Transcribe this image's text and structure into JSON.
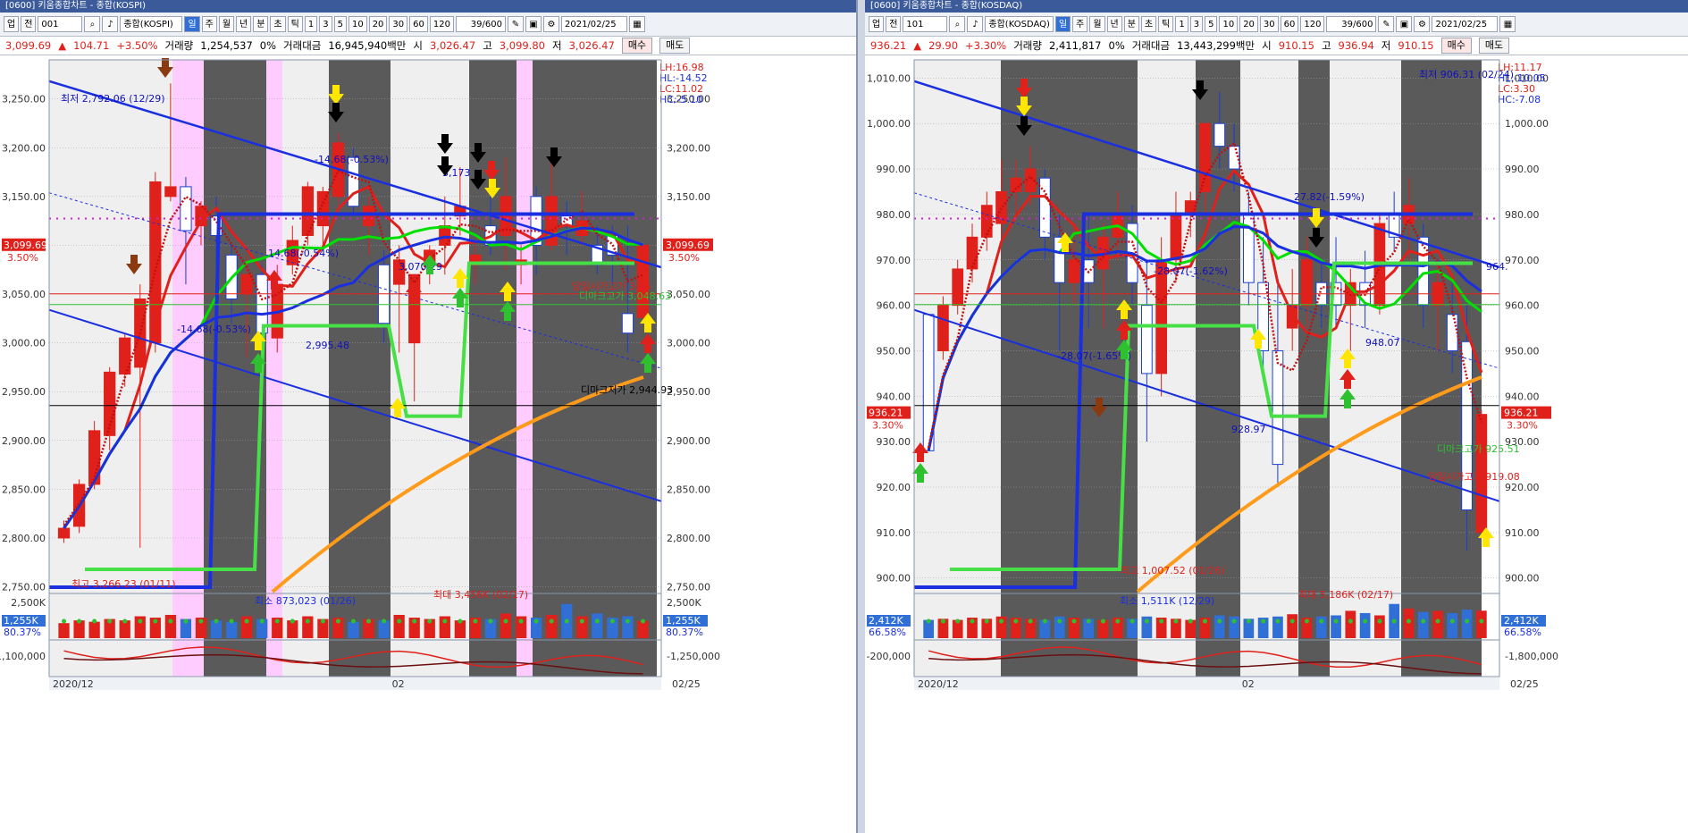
{
  "panels": [
    {
      "title": "[0600] 키움종합차트 - 종합(KOSPI)",
      "toolbar": {
        "buttons": [
          "업",
          "전"
        ],
        "code": "001",
        "name": "종합(KOSPI)",
        "period_tabs": [
          "일",
          "주",
          "월",
          "년",
          "분",
          "초",
          "틱"
        ],
        "active_tab": "일",
        "intervals": [
          "1",
          "3",
          "5",
          "10",
          "20",
          "30",
          "60",
          "120"
        ],
        "count": "39/600",
        "date": "2021/02/25"
      },
      "quote": {
        "price": "3,099.69",
        "arrow": "▲",
        "change": "104.71",
        "pct": "+3.50%",
        "vol_label": "거래량",
        "volume": "1,254,537",
        "zero_pct": "0%",
        "amt_label": "거래대금",
        "amount": "16,945,940백만",
        "open_label": "시",
        "open": "3,026.47",
        "high_label": "고",
        "high": "3,099.80",
        "low_label": "저",
        "low": "3,026.47",
        "buy": "매수",
        "sell": "매도"
      },
      "legend": {
        "lh": "LH:16.98",
        "hl": "HL:-14.52",
        "lc": "LC:11.02",
        "hc": "HC:-5.10"
      },
      "chart_data": {
        "type": "candlestick",
        "x_start": "2020/12",
        "x_mid": "02",
        "x_end": "02/25",
        "y_ticks": [
          "3,250.00",
          "3,200.00",
          "3,150.00",
          "3,100.00",
          "3,050.00",
          "3,000.00",
          "2,950.00",
          "2,900.00",
          "2,850.00",
          "2,800.00",
          "2,750.00"
        ],
        "ylim": [
          2745,
          3290
        ],
        "price_tag": "3,099.69",
        "price_tag_pct": "3.50%",
        "annotations": [
          "최저 2,792.06 (12/29)",
          "-14.68(-0.53%)",
          "3,173",
          "14.68(-0.54%)",
          "3,070.29",
          "-14.68(-0.53%)",
          "2,995.48",
          "당일시가고가 3,05",
          "디마크고가 3,048.63",
          "디마크저가 2,944.93",
          "최고 3,266.23 (01/11)"
        ],
        "candles": [
          [
            2800,
            2818,
            2795,
            2810
          ],
          [
            2812,
            2860,
            2805,
            2855
          ],
          [
            2855,
            2920,
            2850,
            2910
          ],
          [
            2905,
            2975,
            2890,
            2970
          ],
          [
            2968,
            3010,
            2955,
            3005
          ],
          [
            2975,
            3060,
            2790,
            3045
          ],
          [
            3000,
            3175,
            2990,
            3165
          ],
          [
            3150,
            3266,
            3145,
            3160
          ],
          [
            3160,
            3170,
            3060,
            3115
          ],
          [
            3120,
            3145,
            3100,
            3140
          ],
          [
            3130,
            3150,
            3080,
            3110
          ],
          [
            3090,
            3100,
            3020,
            3045
          ],
          [
            3050,
            3090,
            2985,
            3070
          ],
          [
            3070,
            3080,
            2990,
            3010
          ],
          [
            3005,
            3080,
            2990,
            3060
          ],
          [
            3080,
            3120,
            3070,
            3105
          ],
          [
            3110,
            3165,
            3100,
            3160
          ],
          [
            3120,
            3160,
            3100,
            3155
          ],
          [
            3150,
            3215,
            3140,
            3205
          ],
          [
            3190,
            3200,
            3130,
            3140
          ],
          [
            3120,
            3150,
            3090,
            3140
          ],
          [
            3080,
            3095,
            3000,
            3020
          ],
          [
            3060,
            3100,
            2990,
            3085
          ],
          [
            3000,
            3070,
            2940,
            3070
          ],
          [
            3080,
            3100,
            3060,
            3095
          ],
          [
            3100,
            3150,
            3070,
            3120
          ],
          [
            3130,
            3180,
            3110,
            3140
          ],
          [
            3080,
            3100,
            3060,
            3090
          ],
          [
            3120,
            3160,
            3090,
            3100
          ],
          [
            3110,
            3190,
            3075,
            3150
          ],
          [
            3080,
            3100,
            3060,
            3085
          ],
          [
            3150,
            3160,
            3070,
            3100
          ],
          [
            3100,
            3190,
            3095,
            3150
          ],
          [
            3130,
            3145,
            3090,
            3120
          ],
          [
            3110,
            3155,
            3100,
            3125
          ],
          [
            3100,
            3120,
            3070,
            3080
          ],
          [
            3110,
            3120,
            3060,
            3090
          ],
          [
            3030,
            3120,
            2990,
            3010
          ],
          [
            3026,
            3100,
            3026,
            3100
          ]
        ],
        "volume": {
          "label_top": "2,500K",
          "label_cur": "1,255K",
          "label_pct": "80.37%",
          "min_label": "최소 873,023 (01/26)",
          "max_label": "최대 3,456K (02/17)",
          "osc_label": "-1,100,000",
          "osc_label_r": "-1,250,000",
          "values": [
            1.1,
            1.3,
            1.2,
            1.4,
            1.3,
            1.6,
            1.5,
            1.7,
            1.4,
            1.5,
            1.3,
            1.2,
            1.6,
            1.4,
            1.5,
            1.3,
            1.6,
            1.4,
            1.5,
            1.2,
            1.4,
            1.3,
            1.7,
            1.5,
            1.4,
            1.6,
            1.3,
            1.5,
            1.4,
            1.8,
            1.6,
            1.5,
            1.7,
            2.5,
            1.6,
            1.8,
            1.5,
            1.6,
            1.26
          ]
        }
      }
    },
    {
      "title": "[0600] 키움종합차트 - 종합(KOSDAQ)",
      "toolbar": {
        "buttons": [
          "업",
          "전"
        ],
        "code": "101",
        "name": "종합(KOSDAQ)",
        "period_tabs": [
          "일",
          "주",
          "월",
          "년",
          "분",
          "초",
          "틱"
        ],
        "active_tab": "일",
        "intervals": [
          "1",
          "3",
          "5",
          "10",
          "20",
          "30",
          "60",
          "120"
        ],
        "count": "39/600",
        "date": "2021/02/25"
      },
      "quote": {
        "price": "936.21",
        "arrow": "▲",
        "change": "29.90",
        "pct": "+3.30%",
        "vol_label": "거래량",
        "volume": "2,411,817",
        "zero_pct": "0%",
        "amt_label": "거래대금",
        "amount": "13,443,299백만",
        "open_label": "시",
        "open": "910.15",
        "high_label": "고",
        "high": "936.94",
        "low_label": "저",
        "low": "910.15",
        "buy": "매수",
        "sell": "매도"
      },
      "legend": {
        "lh": "LH:11.17",
        "hl": "HL:-10.05",
        "lc": "LC:3.30",
        "hc": "HC:-7.08"
      },
      "chart_data": {
        "type": "candlestick",
        "x_start": "2020/12",
        "x_mid": "02",
        "x_end": "02/25",
        "y_ticks": [
          "1,010.00",
          "1,000.00",
          "990.00",
          "980.00",
          "970.00",
          "960.00",
          "950.00",
          "940.00",
          "930.00",
          "920.00",
          "910.00",
          "900.00"
        ],
        "ylim": [
          897,
          1014
        ],
        "price_tag": "936.21",
        "price_tag_pct": "3.30%",
        "annotations": [
          "최저 906.31 (02/24)",
          "27.82(-1.59%)",
          "-28.07(-1.62%)",
          "-28.07(-1.65%)",
          "948.07",
          "928.97",
          "디마크고가 925.51",
          "당일시가고가 919.08",
          "최고 1,007.52 (01/26)",
          "964."
        ],
        "candles": [
          [
            958,
            958,
            928,
            928
          ],
          [
            950,
            962,
            948,
            960
          ],
          [
            960,
            970,
            958,
            968
          ],
          [
            968,
            978,
            965,
            975
          ],
          [
            975,
            985,
            972,
            982
          ],
          [
            978,
            992,
            975,
            985
          ],
          [
            985,
            992,
            980,
            988
          ],
          [
            985,
            995,
            982,
            990
          ],
          [
            988,
            990,
            970,
            975
          ],
          [
            975,
            980,
            950,
            965
          ],
          [
            965,
            978,
            960,
            970
          ],
          [
            970,
            980,
            955,
            965
          ],
          [
            968,
            978,
            955,
            975
          ],
          [
            975,
            985,
            970,
            980
          ],
          [
            978,
            982,
            960,
            965
          ],
          [
            960,
            970,
            930,
            945
          ],
          [
            945,
            975,
            940,
            970
          ],
          [
            970,
            985,
            965,
            980
          ],
          [
            980,
            985,
            975,
            983
          ],
          [
            985,
            998,
            980,
            1000
          ],
          [
            1000,
            1007,
            990,
            995
          ],
          [
            995,
            1000,
            985,
            990
          ],
          [
            980,
            985,
            960,
            965
          ],
          [
            965,
            975,
            945,
            950
          ],
          [
            950,
            965,
            920,
            925
          ],
          [
            955,
            968,
            950,
            960
          ],
          [
            960,
            975,
            955,
            970
          ],
          [
            965,
            970,
            955,
            960
          ],
          [
            965,
            975,
            955,
            960
          ],
          [
            960,
            968,
            950,
            965
          ],
          [
            965,
            972,
            955,
            960
          ],
          [
            960,
            980,
            958,
            978
          ],
          [
            980,
            985,
            972,
            975
          ],
          [
            978,
            988,
            970,
            982
          ],
          [
            975,
            978,
            955,
            960
          ],
          [
            960,
            970,
            950,
            965
          ],
          [
            958,
            965,
            945,
            950
          ],
          [
            952,
            960,
            906,
            915
          ],
          [
            910,
            937,
            910,
            936
          ]
        ],
        "volume": {
          "label_cur": "2,412K",
          "label_pct": "66.58%",
          "min_label": "최소 1,511K (12/29)",
          "max_label": "최대 5,186K (02/17)",
          "osc_label": "-200,000",
          "osc_label_r": "-1,800,000",
          "values": [
            1.6,
            1.7,
            1.6,
            1.8,
            1.7,
            1.9,
            1.8,
            1.7,
            1.6,
            1.9,
            1.8,
            1.7,
            1.6,
            1.8,
            1.7,
            1.9,
            1.8,
            1.7,
            1.6,
            1.8,
            2.0,
            1.9,
            1.7,
            1.8,
            1.9,
            2.1,
            1.8,
            1.9,
            2.0,
            2.4,
            2.2,
            2.0,
            3.0,
            2.6,
            2.3,
            2.4,
            2.2,
            2.5,
            2.41
          ]
        }
      }
    }
  ]
}
